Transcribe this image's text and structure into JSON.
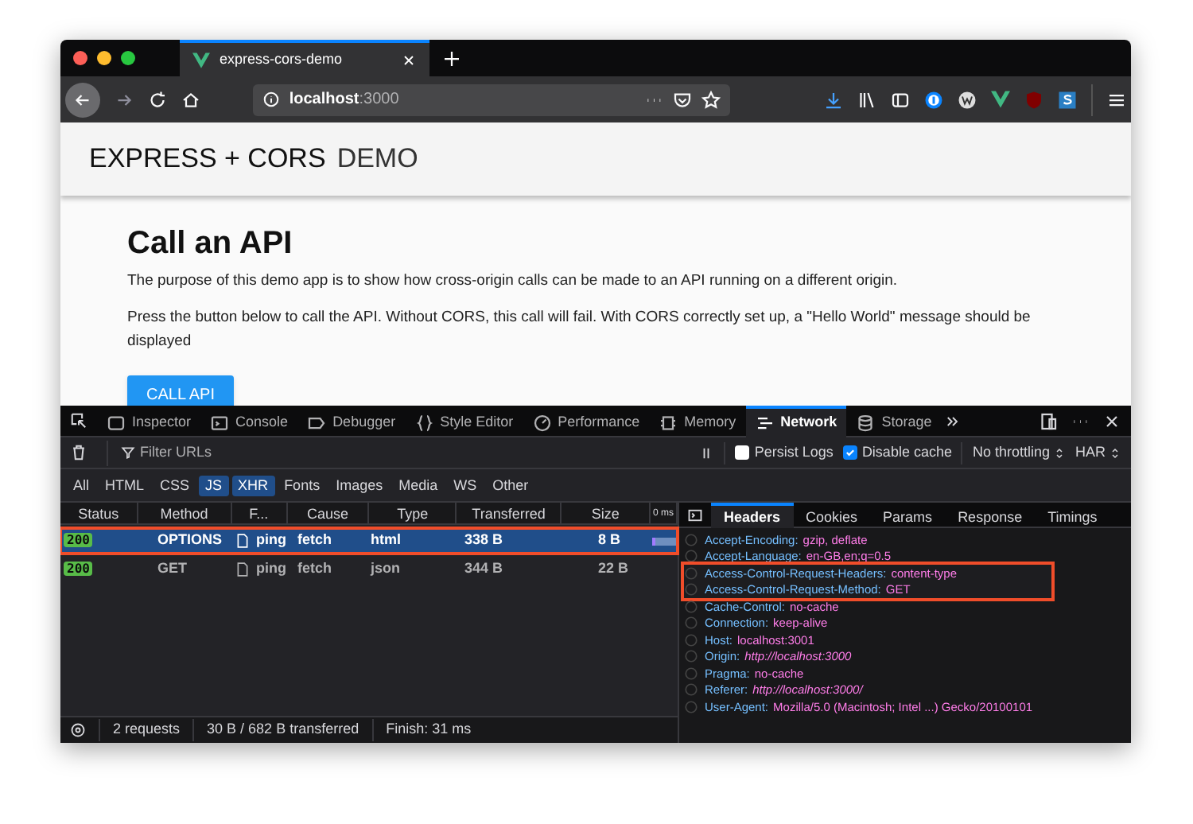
{
  "browser_tab": {
    "title": "express-cors-demo"
  },
  "address_bar": {
    "host": "localhost",
    "port": ":3000"
  },
  "page": {
    "brand": "EXPRESS + CORS",
    "brand_suffix": "DEMO",
    "heading": "Call an API",
    "paragraphs": [
      "The purpose of this demo app is to show how cross-origin calls can be made to an API running on a different origin.",
      "Press the button below to call the API. Without CORS, this call will fail. With CORS correctly set up, a \"Hello World\" message should be displayed"
    ],
    "button": "CALL API"
  },
  "devtools": {
    "tabs": [
      {
        "label": "Inspector",
        "selected": false
      },
      {
        "label": "Console",
        "selected": false
      },
      {
        "label": "Debugger",
        "selected": false
      },
      {
        "label": "Style Editor",
        "selected": false
      },
      {
        "label": "Performance",
        "selected": false
      },
      {
        "label": "Memory",
        "selected": false
      },
      {
        "label": "Network",
        "selected": true
      },
      {
        "label": "Storage",
        "selected": false
      }
    ],
    "filter": {
      "placeholder": "Filter URLs"
    },
    "options": [
      {
        "label": "Persist Logs",
        "checked": false
      },
      {
        "label": "Disable cache",
        "checked": true
      }
    ],
    "throttling": "No throttling",
    "har": "HAR",
    "type_filters": [
      {
        "label": "All",
        "selected": false
      },
      {
        "label": "HTML",
        "selected": false
      },
      {
        "label": "CSS",
        "selected": false
      },
      {
        "label": "JS",
        "selected": true
      },
      {
        "label": "XHR",
        "selected": true
      },
      {
        "label": "Fonts",
        "selected": false
      },
      {
        "label": "Images",
        "selected": false
      },
      {
        "label": "Media",
        "selected": false
      },
      {
        "label": "WS",
        "selected": false
      },
      {
        "label": "Other",
        "selected": false
      }
    ],
    "columns": [
      "Status",
      "Method",
      "F...",
      "Cause",
      "Type",
      "Transferred",
      "Size",
      "0 ms"
    ],
    "requests": [
      {
        "status": "200",
        "method": "OPTIONS",
        "file": "ping",
        "cause": "fetch",
        "type": "html",
        "transferred": "338 B",
        "size": "8 B",
        "selected": true,
        "highlighted": true
      },
      {
        "status": "200",
        "method": "GET",
        "file": "ping",
        "cause": "fetch",
        "type": "json",
        "transferred": "344 B",
        "size": "22 B",
        "selected": false,
        "highlighted": false
      }
    ],
    "detail_tabs": [
      {
        "label": "Headers",
        "selected": true
      },
      {
        "label": "Cookies",
        "selected": false
      },
      {
        "label": "Params",
        "selected": false
      },
      {
        "label": "Response",
        "selected": false
      },
      {
        "label": "Timings",
        "selected": false
      }
    ],
    "headers": [
      {
        "name": "Accept-Encoding:",
        "value": "gzip, deflate",
        "italic": false,
        "highlighted": false
      },
      {
        "name": "Accept-Language:",
        "value": "en-GB,en;q=0.5",
        "italic": false,
        "highlighted": false
      },
      {
        "name": "Access-Control-Request-Headers:",
        "value": "content-type",
        "italic": false,
        "highlighted": true
      },
      {
        "name": "Access-Control-Request-Method:",
        "value": "GET",
        "italic": false,
        "highlighted": true
      },
      {
        "name": "Cache-Control:",
        "value": "no-cache",
        "italic": false,
        "highlighted": false
      },
      {
        "name": "Connection:",
        "value": "keep-alive",
        "italic": false,
        "highlighted": false
      },
      {
        "name": "Host:",
        "value": "localhost:3001",
        "italic": false,
        "highlighted": false
      },
      {
        "name": "Origin:",
        "value": "http://localhost:3000",
        "italic": true,
        "highlighted": false
      },
      {
        "name": "Pragma:",
        "value": "no-cache",
        "italic": false,
        "highlighted": false
      },
      {
        "name": "Referer:",
        "value": "http://localhost:3000/",
        "italic": true,
        "highlighted": false
      },
      {
        "name": "User-Agent:",
        "value": "Mozilla/5.0 (Macintosh; Intel ...) Gecko/20100101",
        "italic": false,
        "highlighted": false
      }
    ],
    "status_bar": [
      "2 requests",
      "30 B / 682 B transferred",
      "Finish: 31 ms"
    ]
  }
}
